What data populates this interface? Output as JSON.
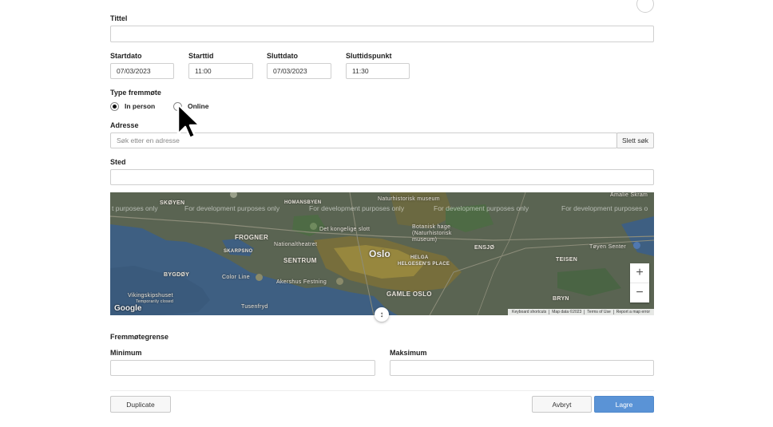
{
  "form": {
    "title_label": "Tittel",
    "title_value": "",
    "start_date_label": "Startdato",
    "start_date_value": "07/03/2023",
    "start_time_label": "Starttid",
    "start_time_value": "11:00",
    "end_date_label": "Sluttdato",
    "end_date_value": "07/03/2023",
    "end_time_label": "Sluttidspunkt",
    "end_time_value": "11:30",
    "attendance_type_label": "Type fremmøte",
    "attendance_options": [
      {
        "label": "In person",
        "checked": true
      },
      {
        "label": "Online",
        "checked": false
      }
    ],
    "address_label": "Adresse",
    "address_placeholder": "Søk etter en adresse",
    "clear_search_label": "Slett søk",
    "place_label": "Sted",
    "place_value": "",
    "attendance_limit_label": "Fremmøtegrense",
    "minimum_label": "Minimum",
    "minimum_value": "",
    "maximum_label": "Maksimum",
    "maximum_value": ""
  },
  "map": {
    "watermark": "For development purposes only",
    "watermark_partial": "t purposes only",
    "watermark_partial_right": "For development purposes o",
    "city": "Oslo",
    "labels": {
      "skoyen": "SKØYEN",
      "homansbyen": "HOMANSBYEN",
      "frogner": "FROGNER",
      "skarpsno": "SKARPSNO",
      "sentrum": "SENTRUM",
      "bygdoy": "BYGDØY",
      "helga": "HELGA",
      "helgesens_place": "HELGESEN'S PLACE",
      "ensjo": "ENSJØ",
      "teisen": "TEISEN",
      "gamle_oslo": "GAMLE OSLO",
      "bryn": "BRYN",
      "slottet": "Det kongelige slott",
      "museum": "Naturhistorisk museum",
      "botanisk": "Botanisk hage (Naturhistorisk museum)",
      "nationaltheatret": "Nationaltheatret",
      "color_line": "Color Line",
      "akershus": "Akershus Festning",
      "vikingskip": "Vikingskipshuset",
      "vikingskip_sub": "Temporarily closed",
      "tusenfryd": "Tusenfryd",
      "tjeneste": "Tøyen Senter",
      "grunerlokka": "Amalie Skram"
    },
    "google_logo": "Google",
    "attribution": [
      "Keyboard shortcuts",
      "Map data ©2023",
      "Terms of Use",
      "Report a map error"
    ],
    "zoom_in": "+",
    "zoom_out": "−",
    "drag_handle": "↕"
  },
  "buttons": {
    "duplicate": "Duplicate",
    "cancel": "Avbryt",
    "save": "Lagre"
  },
  "colors": {
    "primary": "#5a93d6",
    "map_water": "#3f5e7e",
    "map_land": "#5b6652"
  }
}
